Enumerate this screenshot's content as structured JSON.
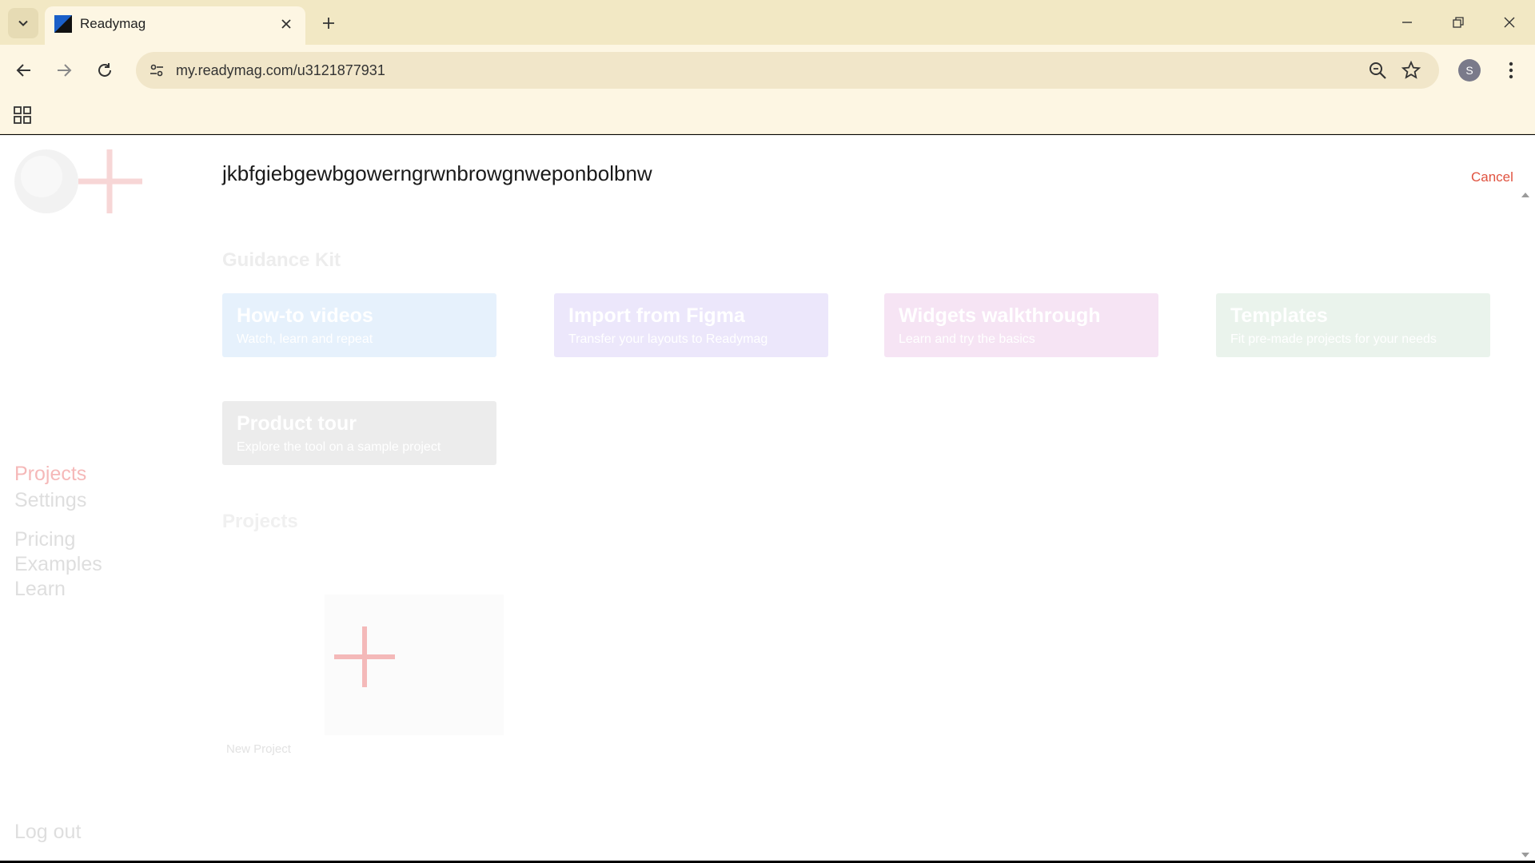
{
  "browser": {
    "tab_title": "Readymag",
    "url": "my.readymag.com/u3121877931",
    "profile_initial": "S"
  },
  "sidebar": {
    "projects": "Projects",
    "settings": "Settings",
    "pricing": "Pricing",
    "examples": "Examples",
    "learn": "Learn",
    "logout": "Log out"
  },
  "header": {
    "project_title": "jkbfgiebgewbgowerngrwnbrowgnweponbolbnw",
    "cancel": "Cancel"
  },
  "guidance": {
    "heading": "Guidance Kit",
    "cards": [
      {
        "title": "How-to videos",
        "subtitle": "Watch, learn and repeat"
      },
      {
        "title": "Import from Figma",
        "subtitle": "Transfer your layouts to Readymag"
      },
      {
        "title": "Widgets walkthrough",
        "subtitle": "Learn and try the basics"
      },
      {
        "title": "Templates",
        "subtitle": "Fit pre-made projects for your needs"
      },
      {
        "title": "Product tour",
        "subtitle": "Explore the tool on a sample project"
      }
    ]
  },
  "projects": {
    "heading": "Projects",
    "new_project": "New Project"
  },
  "colors": {
    "accent": "#e0523f",
    "tabstrip": "#f2e8c4",
    "toolbar": "#fdf6e3"
  }
}
